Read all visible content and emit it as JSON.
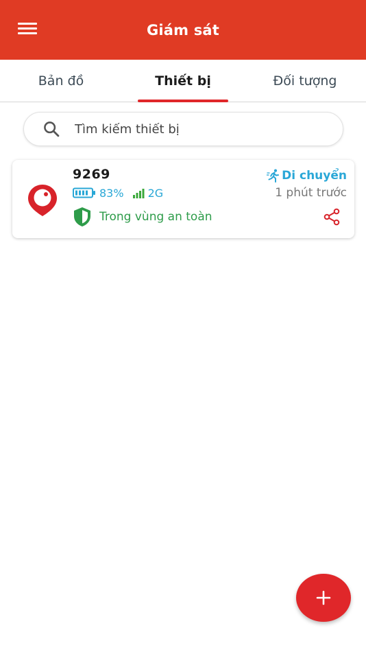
{
  "header": {
    "title": "Giám sát",
    "menu_icon": "hamburger-menu-icon",
    "color": "#e03b24"
  },
  "tabs": [
    {
      "label": "Bản đồ",
      "active": false
    },
    {
      "label": "Thiết bị",
      "active": true
    },
    {
      "label": "Đối tượng",
      "active": false
    }
  ],
  "search": {
    "placeholder": "Tìm kiếm thiết bị",
    "value": ""
  },
  "devices": [
    {
      "name": "9269",
      "battery": "83%",
      "battery_level": 0.83,
      "network": "2G",
      "zone_status": "Trong vùng an toàn",
      "motion_status": "Di chuyển",
      "last_update": "1 phút trước",
      "icons": [
        "battery-icon",
        "signal-icon",
        "shield-check-icon",
        "running-person-icon",
        "share-icon",
        "device-pin-logo-icon"
      ]
    }
  ],
  "fab": {
    "icon": "plus-icon",
    "color": "#e0272a"
  },
  "colors": {
    "accent": "#e0272a",
    "info_blue": "#29a7d6",
    "safe_green": "#2e9c4a"
  }
}
